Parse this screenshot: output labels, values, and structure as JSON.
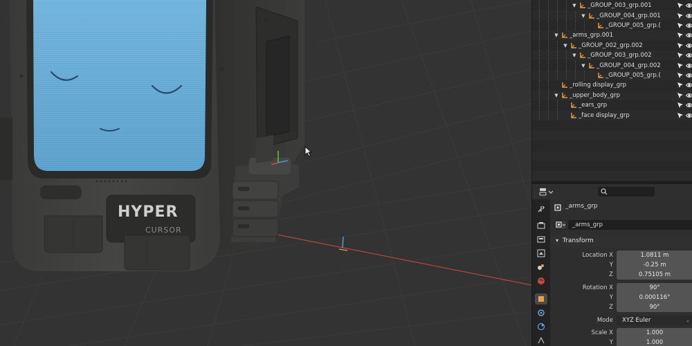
{
  "outliner": {
    "rows": [
      {
        "label": "_GROUP_003_grp.001",
        "expanded": true
      },
      {
        "label": "_GROUP_004_grp.001",
        "expanded": true
      },
      {
        "label": "_GROUP_005_grp.(",
        "expanded": null
      },
      {
        "label": "_arms_grp.001",
        "expanded": true
      },
      {
        "label": "_GROUP_002_grp.002",
        "expanded": true
      },
      {
        "label": "_GROUP_003_grp.002",
        "expanded": true
      },
      {
        "label": "_GROUP_004_grp.002",
        "expanded": true
      },
      {
        "label": "_GROUP_005_grp.(",
        "expanded": null
      },
      {
        "label": "_rolling display_grp",
        "expanded": null
      },
      {
        "label": "_upper_body_grp",
        "expanded": true
      },
      {
        "label": "_ears_grp",
        "expanded": null
      },
      {
        "label": "_face display_grp",
        "expanded": null
      }
    ]
  },
  "properties": {
    "object_name": "_arms_grp",
    "data_name": "_arms_grp",
    "panel_title": "Transform",
    "location": {
      "label_x": "Location X",
      "label_y": "Y",
      "label_z": "Z",
      "x": "1.0811 m",
      "y": "-0.25 m",
      "z": "0.75105 m"
    },
    "rotation": {
      "label_x": "Rotation X",
      "label_y": "Y",
      "label_z": "Z",
      "x": "90°",
      "y": "0.000116°",
      "z": "90°"
    },
    "mode": {
      "label": "Mode",
      "value": "XYZ Euler"
    },
    "scale": {
      "label_x": "Scale X",
      "label_y": "Y",
      "x": "1.000",
      "y": "1.000"
    }
  },
  "viewport": {
    "logo_line1": "HYPER",
    "logo_line2": "CURSOR"
  },
  "colors": {
    "accent_orange": "#e8a040",
    "screen_blue": "#6aaed8",
    "x_axis_red": "#c0413a"
  }
}
